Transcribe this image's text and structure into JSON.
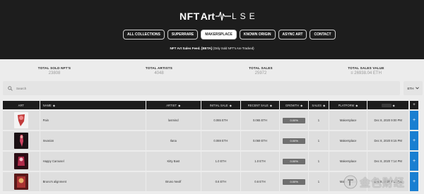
{
  "header": {
    "logo": {
      "part1": "NFT",
      "part2": "Art",
      "part3": "LSE"
    },
    "nav": [
      {
        "label": "ALL COLLECTIONS",
        "active": false
      },
      {
        "label": "SUPERRARE",
        "active": false
      },
      {
        "label": "MAKERSPLACE",
        "active": true
      },
      {
        "label": "KNOWN ORIGIN",
        "active": false
      },
      {
        "label": "ASYNC ART",
        "active": false
      },
      {
        "label": "CONTACT",
        "active": false
      }
    ],
    "feed_title": "NFT Art Sales Feed. [BETA]",
    "feed_note": "(Only Sold NFT's Are Tracked)"
  },
  "stats": [
    {
      "label": "TOTAL SOLD NFT'S",
      "value": "23808"
    },
    {
      "label": "TOTAL ARTISTS",
      "value": "4048"
    },
    {
      "label": "TOTAL SALES",
      "value": "25972"
    },
    {
      "label": "TOTAL SALES VALUE",
      "value": "≡ 26938.04 ETH"
    }
  ],
  "search": {
    "placeholder": "Search"
  },
  "currency": {
    "value": "ETH"
  },
  "table": {
    "headers": {
      "art": "ART",
      "name": "NAME",
      "artist": "ARTIST",
      "initial": "INITIAL SALE",
      "recent": "RECENT SALE",
      "growth": "GROWTH",
      "sales": "SALES",
      "platform": "PLATFORM",
      "date": ""
    },
    "rows": [
      {
        "name": "Pain",
        "artist": "lasmind",
        "initial": "0.065 ETH",
        "recent": "0.065 ETH",
        "growth": "0.00%",
        "sales": "1",
        "platform": "Makersplace",
        "date": "Dec 8, 2020 9:00 PM",
        "thumb": "#c23a3a"
      },
      {
        "name": "Invasion",
        "artist": "Ilana",
        "initial": "0.069 ETH",
        "recent": "0.069 ETH",
        "growth": "0.00%",
        "sales": "1",
        "platform": "Makersplace",
        "date": "Dec 8, 2020 8:15 PM",
        "thumb": "#3a1f2a"
      },
      {
        "name": "Happy Carousel",
        "artist": "Kitty Bast",
        "initial": "1.0 ETH",
        "recent": "1.0 ETH",
        "growth": "0.00%",
        "sales": "1",
        "platform": "Makersplace",
        "date": "Dec 8, 2020 7:14 PM",
        "thumb": "#b02a4a"
      },
      {
        "name": "Bruno's alignment",
        "artist": "Bruno Neolf",
        "initial": "0.6 ETH",
        "recent": "0.6 ETH",
        "growth": "0.00%",
        "sales": "1",
        "platform": "Makersplace",
        "date": "Dec 8, 2020 7:12 PM",
        "thumb": "#8a2a2a"
      }
    ]
  },
  "watermark": {
    "text": "金色财经"
  },
  "colors": {
    "header_bg": "#1d1d1d",
    "accent_blue": "#1a7fd1",
    "growth_badge": "#6f6f6f"
  }
}
